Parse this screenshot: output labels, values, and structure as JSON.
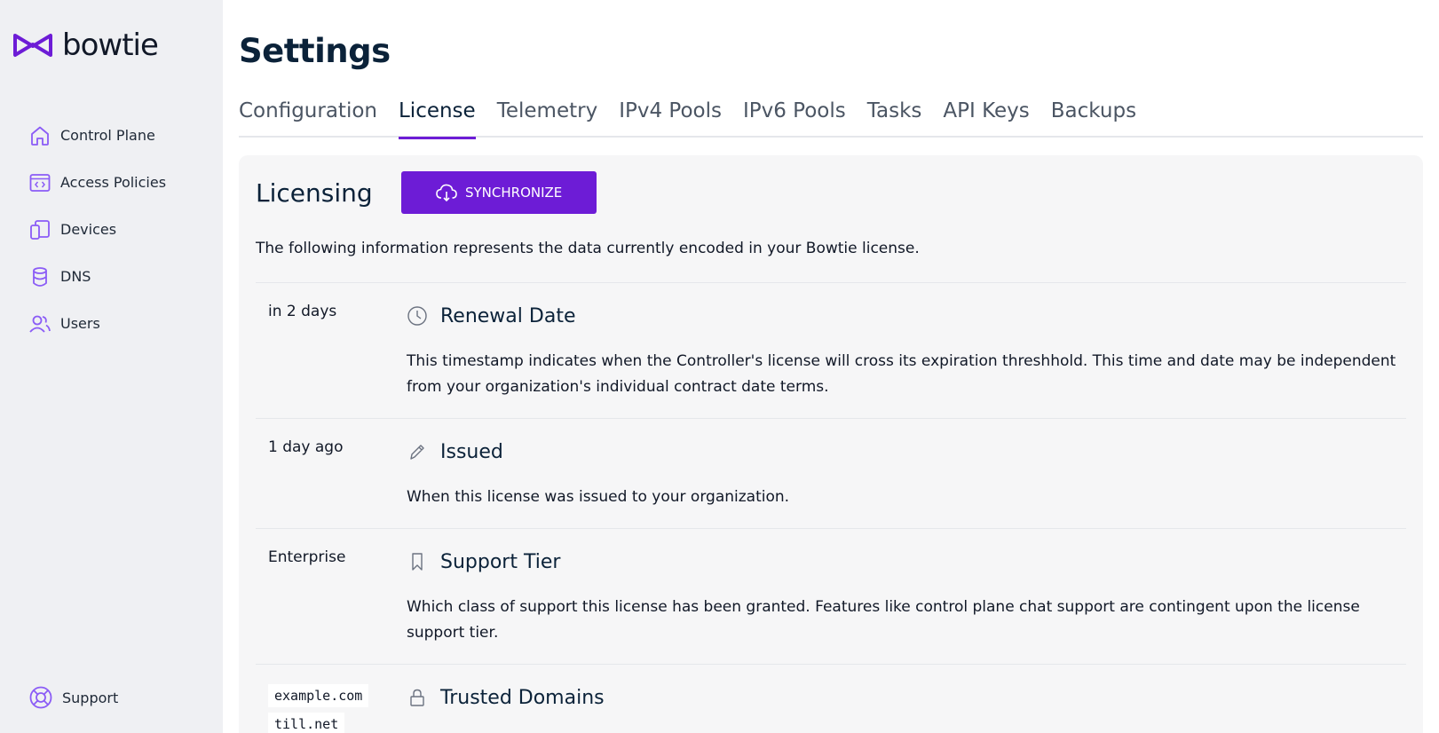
{
  "app": {
    "brand": "bowtie",
    "accent": "#6d1cd6"
  },
  "sidebar": {
    "items": [
      {
        "label": "Control Plane",
        "icon": "home-icon"
      },
      {
        "label": "Access Policies",
        "icon": "code-window-icon"
      },
      {
        "label": "Devices",
        "icon": "devices-icon"
      },
      {
        "label": "DNS",
        "icon": "database-icon"
      },
      {
        "label": "Users",
        "icon": "users-icon"
      }
    ],
    "support_label": "Support"
  },
  "page": {
    "title": "Settings"
  },
  "tabs": [
    {
      "label": "Configuration",
      "active": false
    },
    {
      "label": "License",
      "active": true
    },
    {
      "label": "Telemetry",
      "active": false
    },
    {
      "label": "IPv4 Pools",
      "active": false
    },
    {
      "label": "IPv6 Pools",
      "active": false
    },
    {
      "label": "Tasks",
      "active": false
    },
    {
      "label": "API Keys",
      "active": false
    },
    {
      "label": "Backups",
      "active": false
    }
  ],
  "licensing": {
    "title": "Licensing",
    "sync_label": "SYNCHRONIZE",
    "description": "The following information represents the data currently encoded in your Bowtie license.",
    "rows": [
      {
        "value": "in 2 days",
        "icon": "clock-icon",
        "title": "Renewal Date",
        "description": "This timestamp indicates when the Controller's license will cross its expiration threshhold. This time and date may be independent from your organization's individual contract date terms."
      },
      {
        "value": "1 day ago",
        "icon": "pencil-icon",
        "title": "Issued",
        "description": "When this license was issued to your organization."
      },
      {
        "value": "Enterprise",
        "icon": "bookmark-icon",
        "title": "Support Tier",
        "description": "Which class of support this license has been granted. Features like control plane chat support are contingent upon the license support tier."
      },
      {
        "values": [
          "example.com",
          "till.net"
        ],
        "icon": "lock-icon",
        "title": "Trusted Domains",
        "description": ""
      }
    ]
  }
}
